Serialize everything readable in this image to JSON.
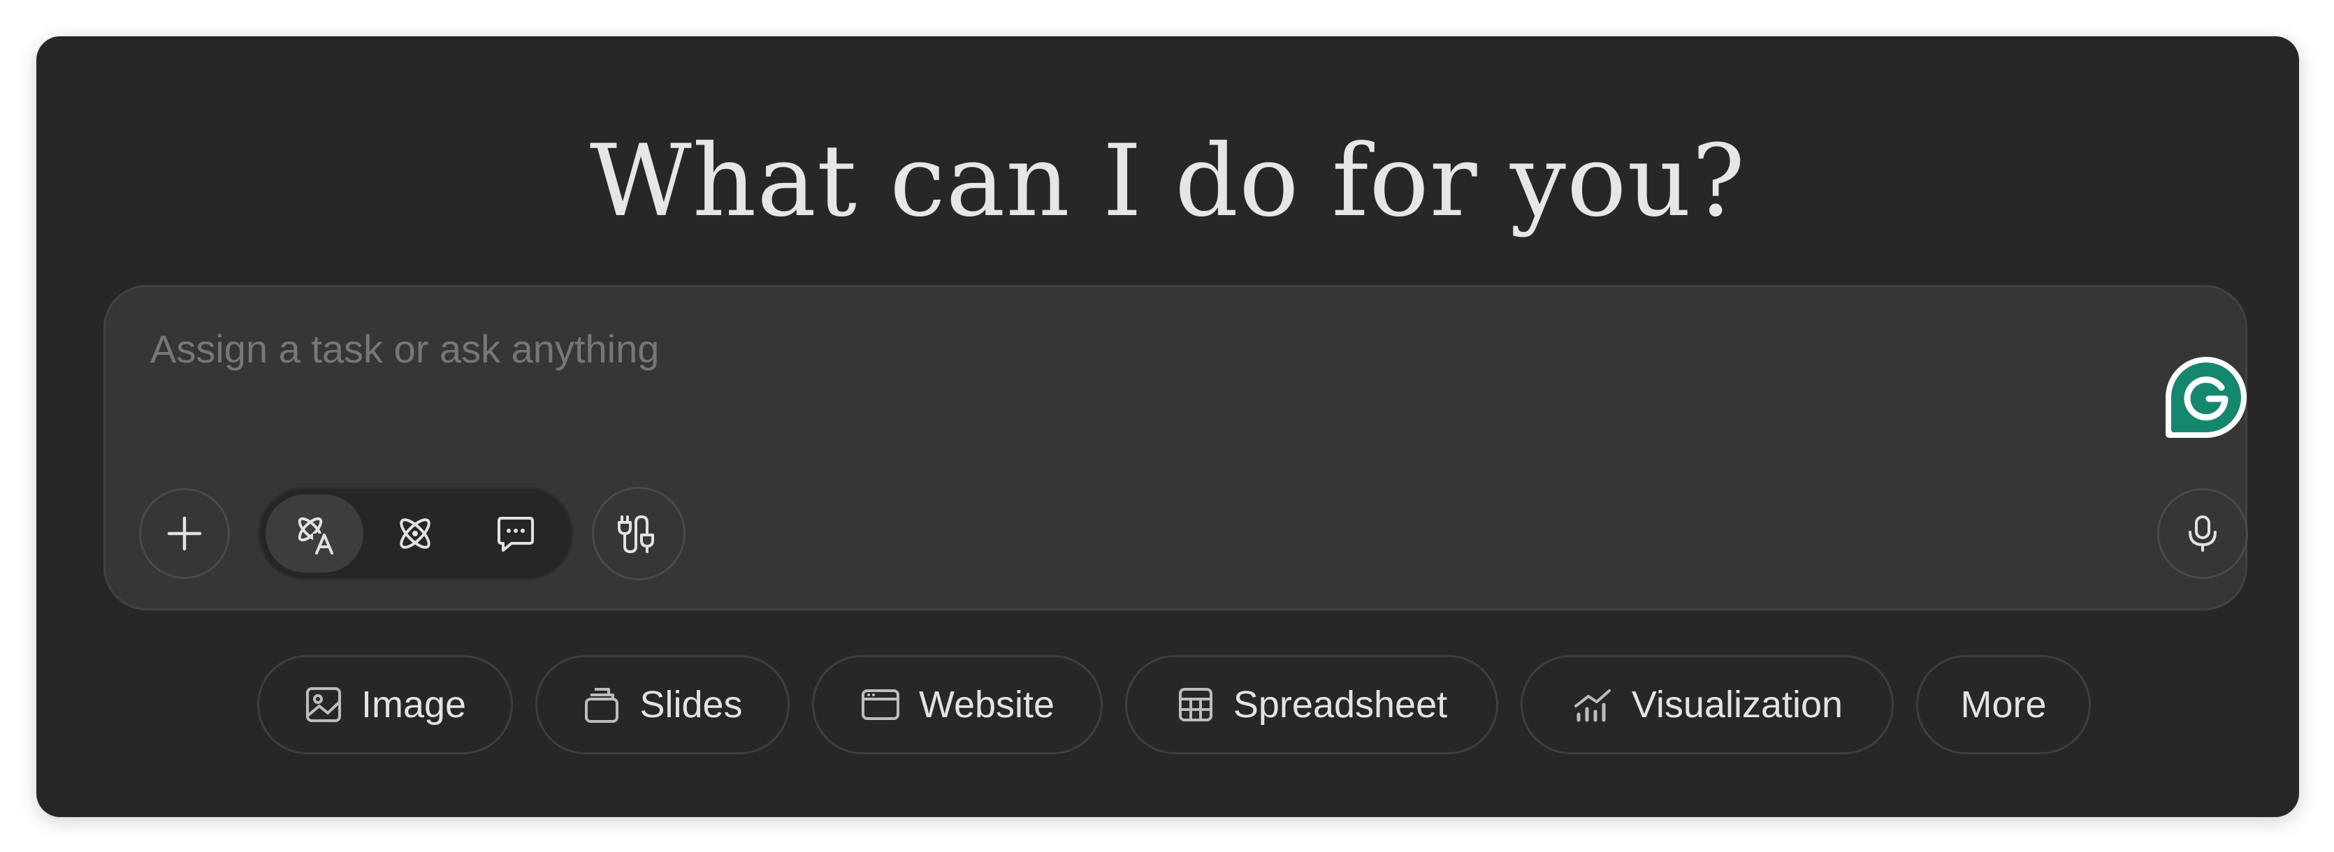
{
  "headline": "What can I do for you?",
  "composer": {
    "placeholder": "Assign a task or ask anything",
    "value": "",
    "modes": [
      {
        "name": "agent-mode",
        "icon": "agent-atom-text-icon",
        "active": true
      },
      {
        "name": "research-mode",
        "icon": "atom-icon",
        "active": false
      },
      {
        "name": "chat-mode",
        "icon": "chat-bubble-icon",
        "active": false
      }
    ]
  },
  "quick_actions": [
    {
      "label": "Image",
      "icon": "image-icon"
    },
    {
      "label": "Slides",
      "icon": "slides-icon"
    },
    {
      "label": "Website",
      "icon": "browser-window-icon"
    },
    {
      "label": "Spreadsheet",
      "icon": "table-grid-icon"
    },
    {
      "label": "Visualization",
      "icon": "bar-chart-icon"
    },
    {
      "label": "More",
      "icon": ""
    }
  ],
  "colors": {
    "background": "#272727",
    "composer": "#363638",
    "text": "#e6e6e6",
    "grammarly": "#15876f"
  }
}
